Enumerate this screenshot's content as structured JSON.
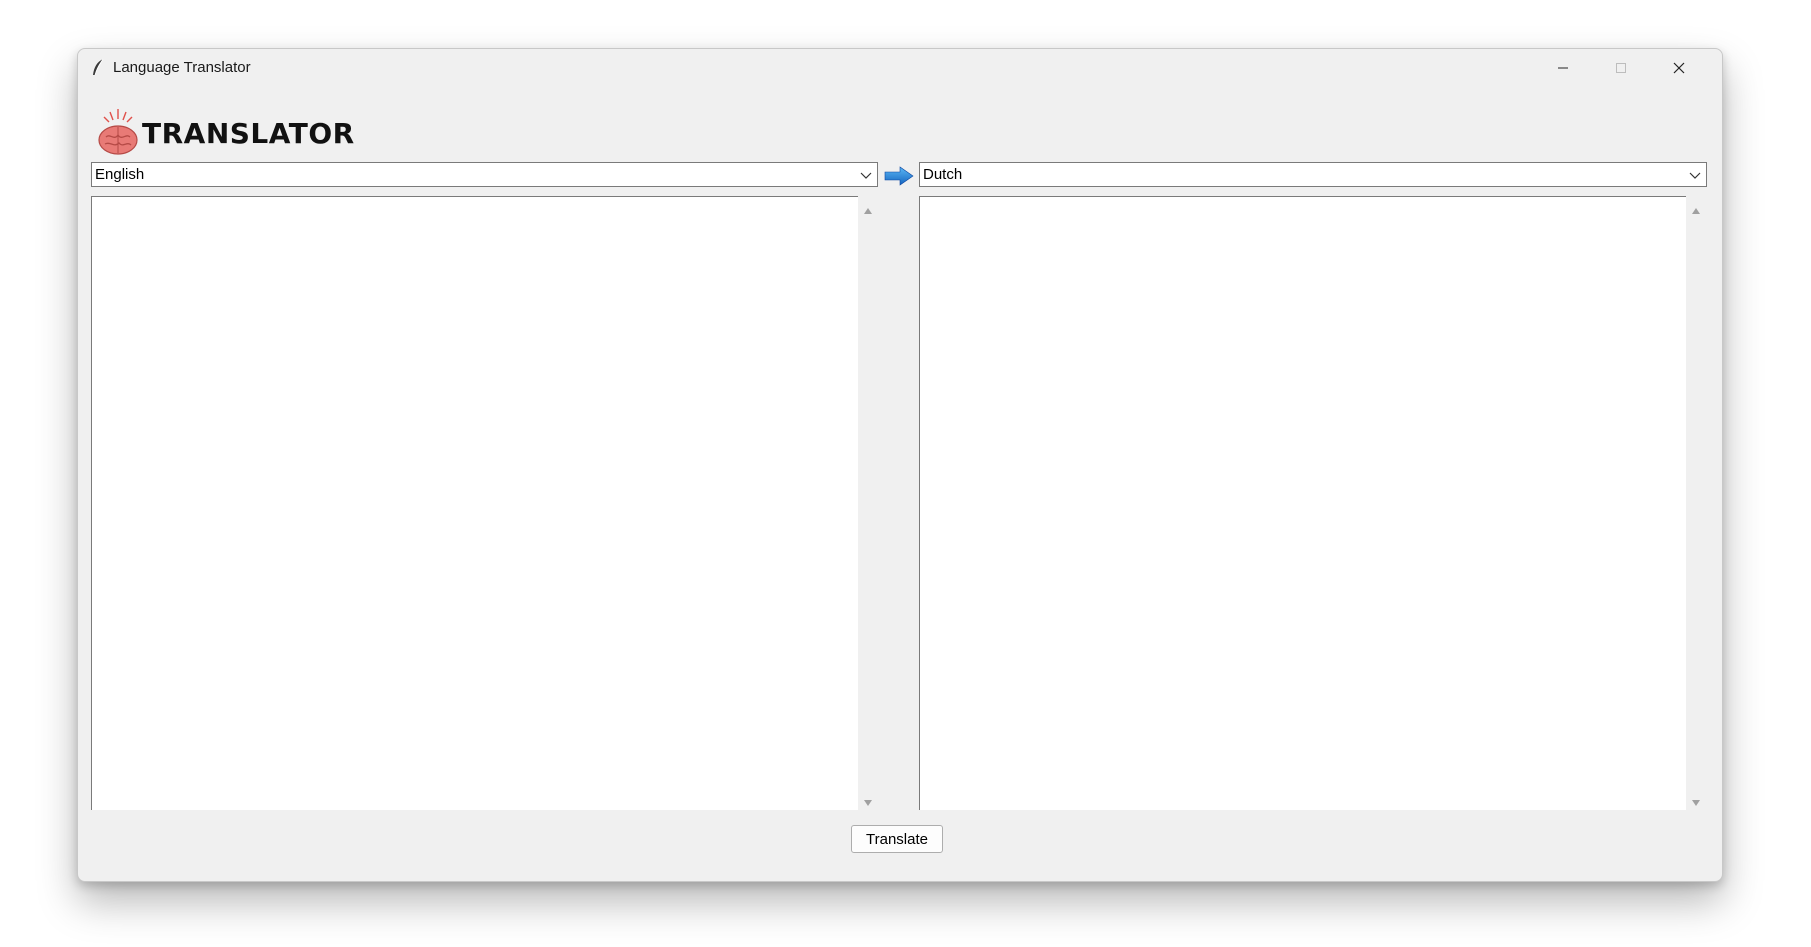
{
  "window": {
    "title": "Language Translator"
  },
  "logo": {
    "text": "TRANSLATOR",
    "icon": "brain-icon"
  },
  "source": {
    "language": "English",
    "text": ""
  },
  "target": {
    "language": "Dutch",
    "text": ""
  },
  "actions": {
    "translate_label": "Translate"
  },
  "colors": {
    "accent_arrow": "#1e88e5",
    "brain": "#e06a6a"
  }
}
